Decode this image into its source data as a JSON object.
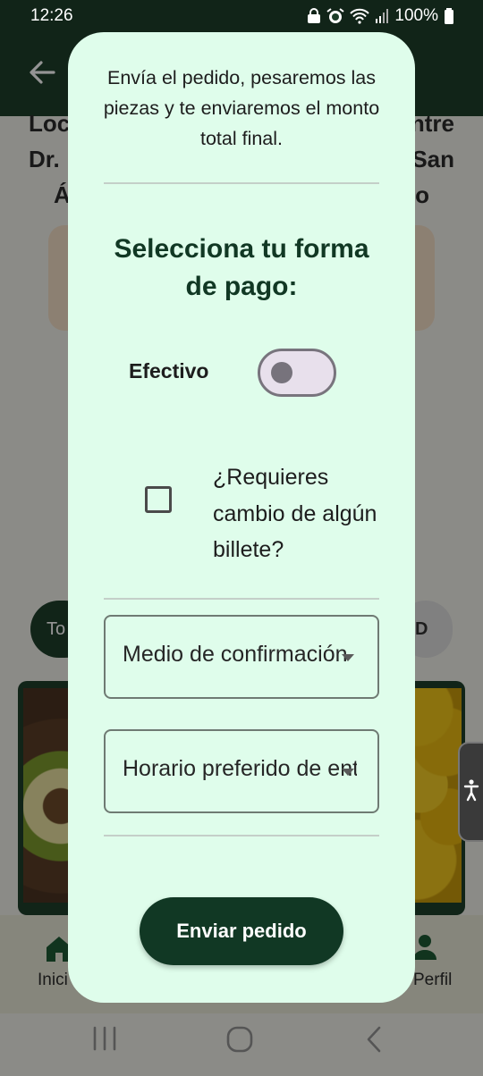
{
  "status_bar": {
    "time": "12:26",
    "battery": "100%",
    "icons": [
      "lock-icon",
      "alarm-icon",
      "wifi-icon",
      "signal-icon",
      "battery-icon"
    ]
  },
  "background": {
    "title_line1_left": "Loc",
    "title_line1_right": "ntre",
    "title_line2_left": "Dr.",
    "title_line2_right": "San",
    "title_line3_left": "Á",
    "title_line3_right": "o",
    "chip_left": "To",
    "chip_right": "D",
    "nav_home_label": "Inici",
    "nav_profile_label": "Perfil"
  },
  "dialog": {
    "info_text": "Envía el pedido, pesaremos las piezas y te enviaremos el monto total final.",
    "payment_title": "Selecciona tu forma de pago:",
    "cash_label": "Efectivo",
    "cash_toggle_on": false,
    "change_checkbox_checked": false,
    "change_question": "¿Requieres cambio de algún billete?",
    "confirmation_dropdown": "Medio de confirmación",
    "schedule_dropdown": "Horario preferido de entrega",
    "send_button": "Enviar pedido"
  },
  "colors": {
    "dialog_bg": "#dffdeb",
    "primary": "#113824",
    "appbar": "#1e3e2a"
  }
}
